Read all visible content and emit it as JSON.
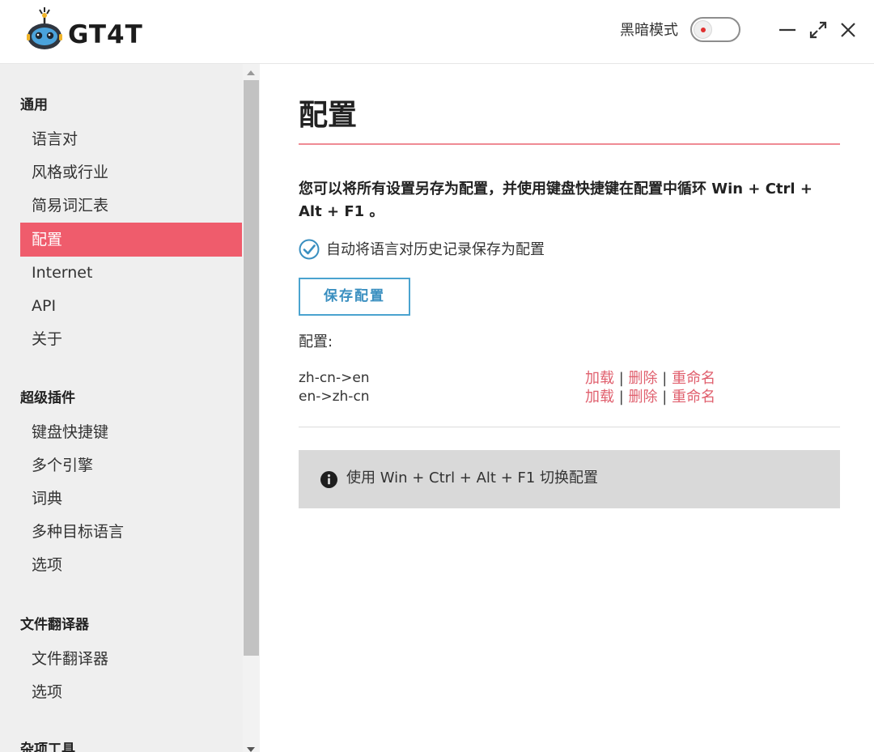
{
  "app": {
    "name": "GT4T"
  },
  "header": {
    "dark_mode_label": "黑暗模式",
    "dark_mode_on": false
  },
  "sidebar": {
    "sections": [
      {
        "title": "通用",
        "items": [
          "语言对",
          "风格或行业",
          "简易词汇表",
          "配置",
          "Internet",
          "API",
          "关于"
        ]
      },
      {
        "title": "超级插件",
        "items": [
          "键盘快捷键",
          "多个引擎",
          "词典",
          "多种目标语言",
          "选项"
        ]
      },
      {
        "title": "文件翻译器",
        "items": [
          "文件翻译器",
          "选项"
        ]
      },
      {
        "title": "杂项工具",
        "items": []
      }
    ],
    "active_item": "配置"
  },
  "main": {
    "title": "配置",
    "description": "您可以将所有设置另存为配置，并使用键盘快捷键在配置中循环 Win + Ctrl + Alt + F1 。",
    "auto_save_checkbox": {
      "label": "自动将语言对历史记录保存为配置",
      "checked": true
    },
    "save_button": "保存配置",
    "configs_label": "配置:",
    "configs": [
      {
        "name": "zh-cn->en",
        "load": "加载",
        "delete": "删除",
        "rename": "重命名"
      },
      {
        "name": "en->zh-cn",
        "load": "加载",
        "delete": "删除",
        "rename": "重命名"
      }
    ],
    "separator": "|",
    "info": "使用 Win + Ctrl + Alt + F1 切换配置"
  },
  "colors": {
    "accent": "#ef5c6c",
    "link": "#e0606e",
    "button_border": "#4aa3cf",
    "checkbox": "#3a8fc0"
  },
  "icons": [
    "robot-logo-icon",
    "minimize-icon",
    "maximize-icon",
    "close-icon",
    "check-circle-icon",
    "info-icon"
  ]
}
